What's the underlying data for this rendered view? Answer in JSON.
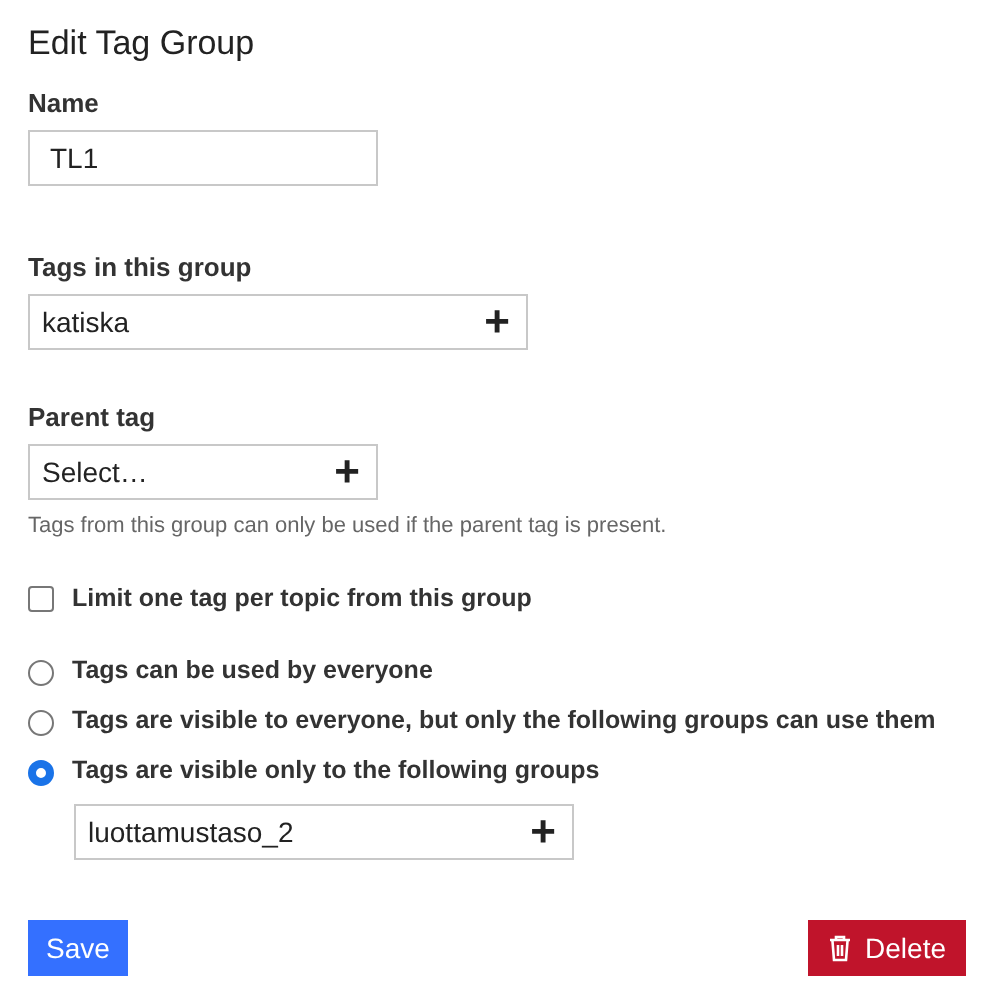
{
  "title": "Edit Tag Group",
  "name_field": {
    "label": "Name",
    "value": "TL1"
  },
  "tags_field": {
    "label": "Tags in this group",
    "value": "katiska",
    "button": "+"
  },
  "parent_field": {
    "label": "Parent tag",
    "value": "Select…",
    "button": "+",
    "help": "Tags from this group can only be used if the parent tag is present."
  },
  "limit_checkbox": {
    "label": "Limit one tag per topic from this group",
    "checked": false
  },
  "visibility": [
    {
      "label": "Tags can be used by everyone",
      "selected": false
    },
    {
      "label": "Tags are visible to everyone, but only the following groups can use them",
      "selected": false
    },
    {
      "label": "Tags are visible only to the following groups",
      "selected": true
    }
  ],
  "groups_field": {
    "value": "luottamustaso_2",
    "button": "+"
  },
  "buttons": {
    "save": "Save",
    "delete": "Delete"
  }
}
